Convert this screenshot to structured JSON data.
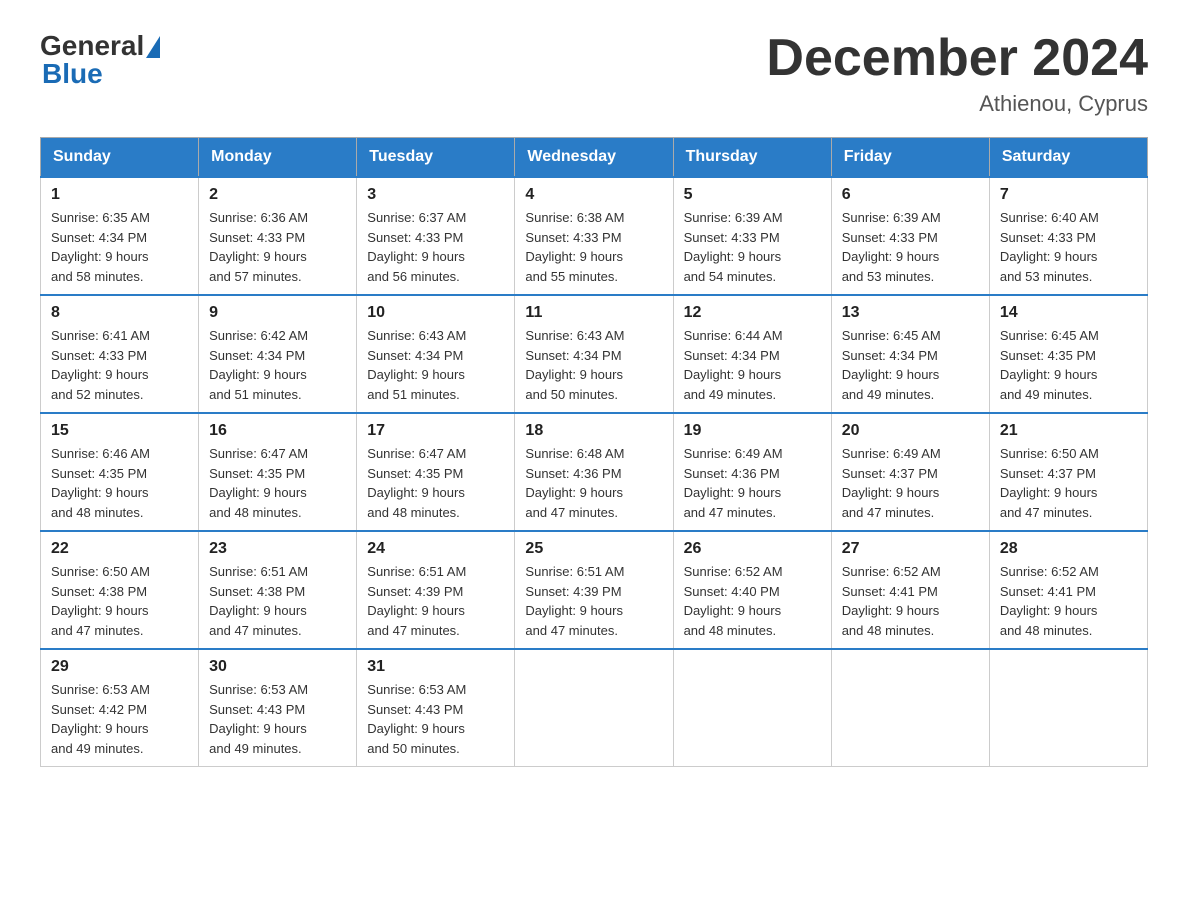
{
  "logo": {
    "general": "General",
    "blue": "Blue"
  },
  "title": "December 2024",
  "location": "Athienou, Cyprus",
  "days_of_week": [
    "Sunday",
    "Monday",
    "Tuesday",
    "Wednesday",
    "Thursday",
    "Friday",
    "Saturday"
  ],
  "weeks": [
    [
      {
        "day": "1",
        "sunrise": "6:35 AM",
        "sunset": "4:34 PM",
        "daylight": "9 hours and 58 minutes."
      },
      {
        "day": "2",
        "sunrise": "6:36 AM",
        "sunset": "4:33 PM",
        "daylight": "9 hours and 57 minutes."
      },
      {
        "day": "3",
        "sunrise": "6:37 AM",
        "sunset": "4:33 PM",
        "daylight": "9 hours and 56 minutes."
      },
      {
        "day": "4",
        "sunrise": "6:38 AM",
        "sunset": "4:33 PM",
        "daylight": "9 hours and 55 minutes."
      },
      {
        "day": "5",
        "sunrise": "6:39 AM",
        "sunset": "4:33 PM",
        "daylight": "9 hours and 54 minutes."
      },
      {
        "day": "6",
        "sunrise": "6:39 AM",
        "sunset": "4:33 PM",
        "daylight": "9 hours and 53 minutes."
      },
      {
        "day": "7",
        "sunrise": "6:40 AM",
        "sunset": "4:33 PM",
        "daylight": "9 hours and 53 minutes."
      }
    ],
    [
      {
        "day": "8",
        "sunrise": "6:41 AM",
        "sunset": "4:33 PM",
        "daylight": "9 hours and 52 minutes."
      },
      {
        "day": "9",
        "sunrise": "6:42 AM",
        "sunset": "4:34 PM",
        "daylight": "9 hours and 51 minutes."
      },
      {
        "day": "10",
        "sunrise": "6:43 AM",
        "sunset": "4:34 PM",
        "daylight": "9 hours and 51 minutes."
      },
      {
        "day": "11",
        "sunrise": "6:43 AM",
        "sunset": "4:34 PM",
        "daylight": "9 hours and 50 minutes."
      },
      {
        "day": "12",
        "sunrise": "6:44 AM",
        "sunset": "4:34 PM",
        "daylight": "9 hours and 49 minutes."
      },
      {
        "day": "13",
        "sunrise": "6:45 AM",
        "sunset": "4:34 PM",
        "daylight": "9 hours and 49 minutes."
      },
      {
        "day": "14",
        "sunrise": "6:45 AM",
        "sunset": "4:35 PM",
        "daylight": "9 hours and 49 minutes."
      }
    ],
    [
      {
        "day": "15",
        "sunrise": "6:46 AM",
        "sunset": "4:35 PM",
        "daylight": "9 hours and 48 minutes."
      },
      {
        "day": "16",
        "sunrise": "6:47 AM",
        "sunset": "4:35 PM",
        "daylight": "9 hours and 48 minutes."
      },
      {
        "day": "17",
        "sunrise": "6:47 AM",
        "sunset": "4:35 PM",
        "daylight": "9 hours and 48 minutes."
      },
      {
        "day": "18",
        "sunrise": "6:48 AM",
        "sunset": "4:36 PM",
        "daylight": "9 hours and 47 minutes."
      },
      {
        "day": "19",
        "sunrise": "6:49 AM",
        "sunset": "4:36 PM",
        "daylight": "9 hours and 47 minutes."
      },
      {
        "day": "20",
        "sunrise": "6:49 AM",
        "sunset": "4:37 PM",
        "daylight": "9 hours and 47 minutes."
      },
      {
        "day": "21",
        "sunrise": "6:50 AM",
        "sunset": "4:37 PM",
        "daylight": "9 hours and 47 minutes."
      }
    ],
    [
      {
        "day": "22",
        "sunrise": "6:50 AM",
        "sunset": "4:38 PM",
        "daylight": "9 hours and 47 minutes."
      },
      {
        "day": "23",
        "sunrise": "6:51 AM",
        "sunset": "4:38 PM",
        "daylight": "9 hours and 47 minutes."
      },
      {
        "day": "24",
        "sunrise": "6:51 AM",
        "sunset": "4:39 PM",
        "daylight": "9 hours and 47 minutes."
      },
      {
        "day": "25",
        "sunrise": "6:51 AM",
        "sunset": "4:39 PM",
        "daylight": "9 hours and 47 minutes."
      },
      {
        "day": "26",
        "sunrise": "6:52 AM",
        "sunset": "4:40 PM",
        "daylight": "9 hours and 48 minutes."
      },
      {
        "day": "27",
        "sunrise": "6:52 AM",
        "sunset": "4:41 PM",
        "daylight": "9 hours and 48 minutes."
      },
      {
        "day": "28",
        "sunrise": "6:52 AM",
        "sunset": "4:41 PM",
        "daylight": "9 hours and 48 minutes."
      }
    ],
    [
      {
        "day": "29",
        "sunrise": "6:53 AM",
        "sunset": "4:42 PM",
        "daylight": "9 hours and 49 minutes."
      },
      {
        "day": "30",
        "sunrise": "6:53 AM",
        "sunset": "4:43 PM",
        "daylight": "9 hours and 49 minutes."
      },
      {
        "day": "31",
        "sunrise": "6:53 AM",
        "sunset": "4:43 PM",
        "daylight": "9 hours and 50 minutes."
      },
      null,
      null,
      null,
      null
    ]
  ],
  "labels": {
    "sunrise": "Sunrise:",
    "sunset": "Sunset:",
    "daylight": "Daylight:"
  }
}
